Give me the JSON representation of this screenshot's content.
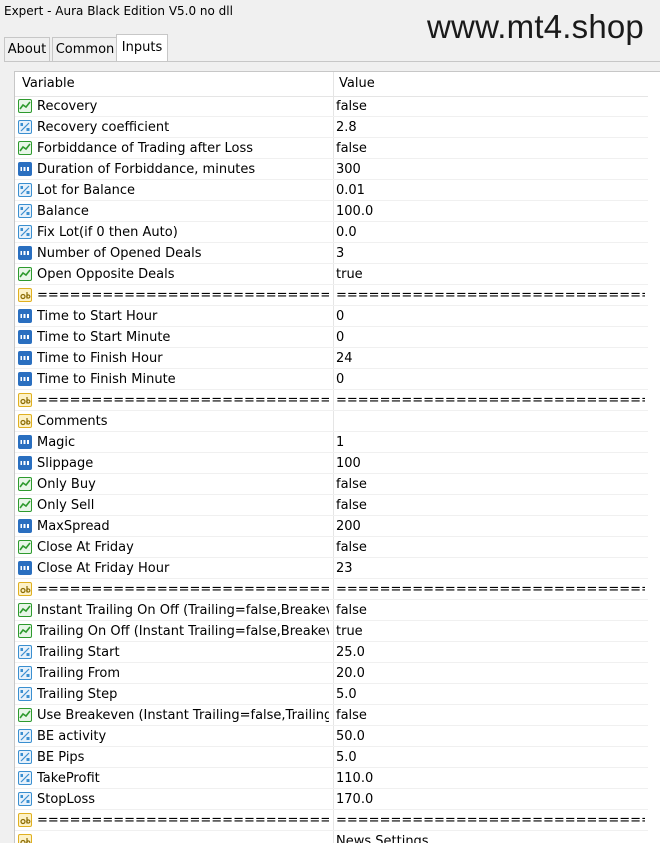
{
  "window": {
    "title": "Expert - Aura Black Edition V5.0 no dll"
  },
  "watermark": "www.mt4.shop",
  "tabs": [
    {
      "label": "About",
      "active": false
    },
    {
      "label": "Common",
      "active": false
    },
    {
      "label": "Inputs",
      "active": true
    }
  ],
  "table": {
    "headers": {
      "variable": "Variable",
      "value": "Value"
    },
    "rows": [
      {
        "name": "Recovery",
        "value": "false",
        "type": "bool"
      },
      {
        "name": "Recovery coefficient",
        "value": "2.8",
        "type": "double"
      },
      {
        "name": "Forbiddance of Trading after Loss",
        "value": "false",
        "type": "bool"
      },
      {
        "name": "Duration of Forbiddance, minutes",
        "value": "300",
        "type": "int"
      },
      {
        "name": "Lot for Balance",
        "value": "0.01",
        "type": "double"
      },
      {
        "name": "Balance",
        "value": "100.0",
        "type": "double"
      },
      {
        "name": "Fix Lot(if 0 then Auto)",
        "value": "0.0",
        "type": "double"
      },
      {
        "name": "Number of Opened Deals",
        "value": "3",
        "type": "int"
      },
      {
        "name": "Open Opposite Deals",
        "value": "true",
        "type": "bool"
      },
      {
        "name": "================================...",
        "value": "========================================...",
        "type": "string"
      },
      {
        "name": "Time to Start Hour",
        "value": "0",
        "type": "int"
      },
      {
        "name": "Time to Start Minute",
        "value": "0",
        "type": "int"
      },
      {
        "name": "Time to Finish Hour",
        "value": "24",
        "type": "int"
      },
      {
        "name": "Time to Finish Minute",
        "value": "0",
        "type": "int"
      },
      {
        "name": "================================...",
        "value": "========================================...",
        "type": "string"
      },
      {
        "name": "Comments",
        "value": "",
        "type": "string"
      },
      {
        "name": "Magic",
        "value": "1",
        "type": "int"
      },
      {
        "name": "Slippage",
        "value": "100",
        "type": "int"
      },
      {
        "name": "Only Buy",
        "value": "false",
        "type": "bool"
      },
      {
        "name": "Only Sell",
        "value": "false",
        "type": "bool"
      },
      {
        "name": "MaxSpread",
        "value": "200",
        "type": "int"
      },
      {
        "name": "Close At Friday",
        "value": "false",
        "type": "bool"
      },
      {
        "name": "Close At Friday Hour",
        "value": "23",
        "type": "int"
      },
      {
        "name": "================================...",
        "value": "========================================...",
        "type": "string"
      },
      {
        "name": "Instant Trailing On Off (Trailing=false,Breakeven...",
        "value": "false",
        "type": "bool"
      },
      {
        "name": "Trailing On Off (Instant Trailing=false,Breakeven...",
        "value": "true",
        "type": "bool"
      },
      {
        "name": "Trailing Start",
        "value": "25.0",
        "type": "double"
      },
      {
        "name": "Trailing From",
        "value": "20.0",
        "type": "double"
      },
      {
        "name": "Trailing Step",
        "value": "5.0",
        "type": "double"
      },
      {
        "name": "Use Breakeven (Instant Trailing=false,Trailing=fa...",
        "value": "false",
        "type": "bool"
      },
      {
        "name": "BE activity",
        "value": "50.0",
        "type": "double"
      },
      {
        "name": "BE Pips",
        "value": "5.0",
        "type": "double"
      },
      {
        "name": "TakeProfit",
        "value": "110.0",
        "type": "double"
      },
      {
        "name": "StopLoss",
        "value": "170.0",
        "type": "double"
      },
      {
        "name": "================================...",
        "value": "========================================...",
        "type": "string"
      },
      {
        "name": "",
        "value": "News Settings",
        "type": "string"
      }
    ]
  },
  "icons": {
    "bool": "bool-type-icon",
    "double": "double-type-icon",
    "int": "int-type-icon",
    "string": "string-type-icon"
  },
  "colors": {
    "bool_green": "#2e9a2e",
    "double_blue": "#3a8fd0",
    "int_blue": "#2a6fc0",
    "string_yellow": "#e0b020"
  }
}
